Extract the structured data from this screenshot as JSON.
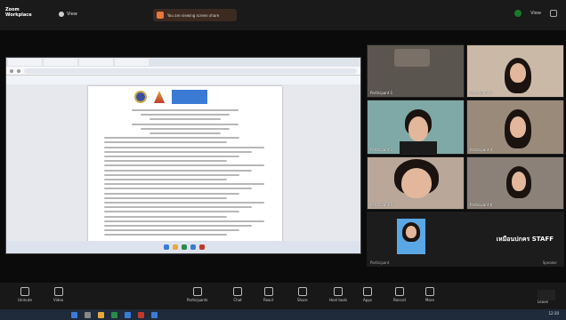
{
  "app": {
    "name_line1": "Zoom",
    "name_line2": "Workplace"
  },
  "view_label": "View",
  "share_banner": "You are viewing screen share",
  "top_right": {
    "label": "View"
  },
  "shared_doc": {
    "page_lines": 28
  },
  "participants": [
    {
      "name": "Participant 1"
    },
    {
      "name": "Participant 2"
    },
    {
      "name": "Participant 3"
    },
    {
      "name": "Participant 4"
    },
    {
      "name": "Participant 5"
    },
    {
      "name": "Participant 6"
    }
  ],
  "speaker": {
    "name": "เหมือนปกคร  STAFF",
    "left_sub": "Participant",
    "right_sub": "Speaker"
  },
  "controls": [
    {
      "label": "Unmute",
      "icon": "mic-icon"
    },
    {
      "label": "Video",
      "icon": "camera-icon"
    },
    {
      "label": "Participants",
      "icon": "people-icon"
    },
    {
      "label": "Chat",
      "icon": "chat-icon"
    },
    {
      "label": "React",
      "icon": "react-icon"
    },
    {
      "label": "Share",
      "icon": "share-icon"
    },
    {
      "label": "Host tools",
      "icon": "shield-icon"
    },
    {
      "label": "Apps",
      "icon": "apps-icon"
    },
    {
      "label": "Record",
      "icon": "record-icon"
    },
    {
      "label": "More",
      "icon": "more-icon"
    }
  ],
  "end_label": "Leave",
  "taskbar": {
    "clock": "12:30"
  }
}
